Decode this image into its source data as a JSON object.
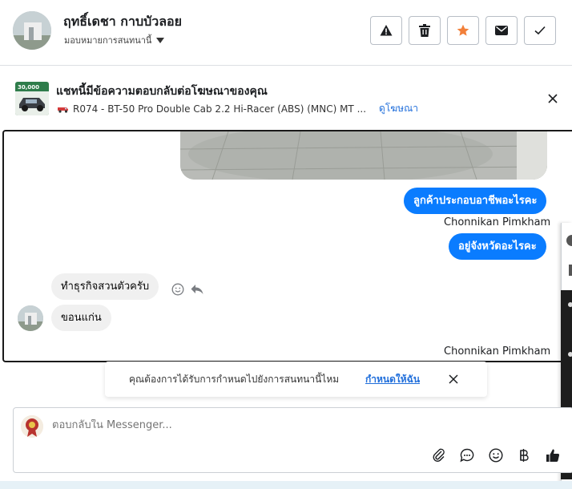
{
  "header": {
    "contact_name": "ฤทธิ์เดชา กาบบัวลอย",
    "assign_label": "มอบหมายการสนทนานี้",
    "buttons": [
      "report",
      "delete",
      "star",
      "mark-unread",
      "done"
    ]
  },
  "ad_banner": {
    "title": "แชทนี้มีข้อความตอบกลับต่อโฆษณาของคุณ",
    "product": "R074 - BT-50 Pro Double Cab 2.2 Hi-Racer (ABS) (MNC) MT ...",
    "view_ad_label": "ดูโฆษณา",
    "thumb_price": "30,000"
  },
  "messages": [
    {
      "direction": "out",
      "text": "ลูกค้าประกอบอาชีพอะไรคะ"
    },
    {
      "direction": "meta",
      "text": "Chonnikan Pimkham"
    },
    {
      "direction": "out",
      "text": "อยู่จังหวัดอะไรคะ"
    },
    {
      "direction": "in",
      "text": "ทำธุรกิจสวนตัวครับ"
    },
    {
      "direction": "in",
      "text": "ขอนแก่น"
    },
    {
      "direction": "meta",
      "text": "Chonnikan Pimkham"
    }
  ],
  "suggestion": {
    "text": "คุณต้องการได้รับการกำหนดไปยังการสนทนานี้ไหม",
    "action_label": "กำหนดให้ฉัน"
  },
  "composer": {
    "placeholder": "ตอบกลับใน Messenger...",
    "icons": [
      "paperclip-icon",
      "chat-bubble-icon",
      "emoji-icon",
      "baht-icon",
      "thumbs-up-icon"
    ]
  },
  "colors": {
    "accent": "#0a7cff",
    "link": "#216fdb",
    "star": "#f2803a",
    "incoming_bubble": "#f0f0f0"
  }
}
